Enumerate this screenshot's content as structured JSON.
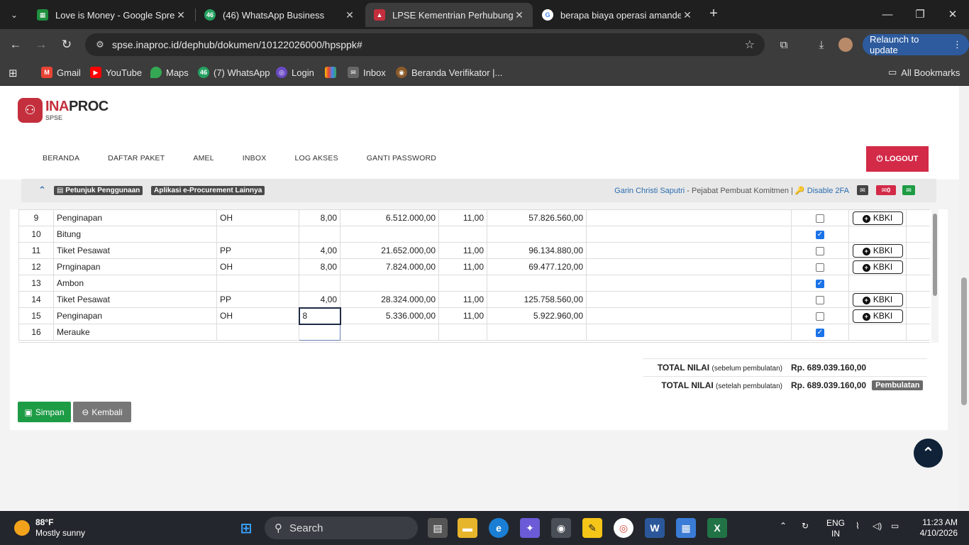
{
  "browser": {
    "tabs": [
      {
        "title": "Love is Money - Google Spread",
        "favicon": "sheets-icon"
      },
      {
        "title": "(46) WhatsApp Business",
        "favicon": "whatsapp-icon",
        "badge": "46"
      },
      {
        "title": "LPSE Kementrian Perhubungan",
        "favicon": "lpse-icon"
      },
      {
        "title": "berapa biaya operasi amandel",
        "favicon": "google-icon"
      }
    ],
    "url": "spse.inaproc.id/dephub/dokumen/10122026000/hpsppk#",
    "relaunch_label": "Relaunch to update",
    "bookmarks": [
      {
        "label": "Gmail"
      },
      {
        "label": "YouTube"
      },
      {
        "label": "Maps"
      },
      {
        "label": "(7) WhatsApp",
        "badge": "46"
      },
      {
        "label": "Login"
      },
      {
        "label": ""
      },
      {
        "label": "Inbox"
      },
      {
        "label": "Beranda Verifikator |..."
      }
    ],
    "all_bookmarks": "All Bookmarks"
  },
  "site": {
    "logo_ina": "INA",
    "logo_proc": "PROC",
    "logo_sub": "SPSE",
    "nav": [
      "BERANDA",
      "DAFTAR PAKET",
      "AMEL",
      "INBOX",
      "LOG AKSES",
      "GANTI PASSWORD"
    ],
    "logout": "LOGOUT",
    "pills": [
      "Petunjuk Penggunaan",
      "Aplikasi e-Procurement Lainnya"
    ],
    "user_name": "Garin Christi Saputri",
    "user_role": " - Pejabat Pembuat Komitmen | ",
    "disable_2fa": "Disable 2FA",
    "mail_count": "0"
  },
  "table": {
    "rows": [
      {
        "no": "9",
        "item": "Penginapan",
        "unit": "OH",
        "qty": "8,00",
        "price": "6.512.000,00",
        "tax": "11,00",
        "total": "57.826.560,00",
        "checked": false,
        "kbki": true
      },
      {
        "no": "10",
        "item": "Bitung",
        "unit": "",
        "qty": "",
        "price": "",
        "tax": "",
        "total": "",
        "checked": true,
        "kbki": false
      },
      {
        "no": "11",
        "item": "Tiket Pesawat",
        "unit": "PP",
        "qty": "4,00",
        "price": "21.652.000,00",
        "tax": "11,00",
        "total": "96.134.880,00",
        "checked": false,
        "kbki": true
      },
      {
        "no": "12",
        "item": "Prnginapan",
        "unit": "OH",
        "qty": "8,00",
        "price": "7.824.000,00",
        "tax": "11,00",
        "total": "69.477.120,00",
        "checked": false,
        "kbki": true
      },
      {
        "no": "13",
        "item": "Ambon",
        "unit": "",
        "qty": "",
        "price": "",
        "tax": "",
        "total": "",
        "checked": true,
        "kbki": false
      },
      {
        "no": "14",
        "item": "Tiket Pesawat",
        "unit": "PP",
        "qty": "4,00",
        "price": "28.324.000,00",
        "tax": "11,00",
        "total": "125.758.560,00",
        "checked": false,
        "kbki": true
      },
      {
        "no": "15",
        "item": "Penginapan",
        "unit": "OH",
        "qty": "8",
        "price": "5.336.000,00",
        "tax": "11,00",
        "total": "5.922.960,00",
        "checked": false,
        "kbki": true,
        "editing": true
      },
      {
        "no": "16",
        "item": "Merauke",
        "unit": "",
        "qty": "",
        "price": "",
        "tax": "",
        "total": "",
        "checked": true,
        "kbki": false
      }
    ],
    "kbki_label": "KBKI"
  },
  "totals": {
    "before_label": "TOTAL NILAI",
    "before_note": "(sebelum pembulatan)",
    "before_value": "Rp. 689.039.160,00",
    "after_label": "TOTAL NILAI",
    "after_note": "(setelah pembulatan)",
    "after_value": "Rp. 689.039.160,00",
    "round_button": "Pembulatan"
  },
  "buttons": {
    "save": "Simpan",
    "back": "Kembali"
  },
  "taskbar": {
    "temp": "88°F",
    "weather": "Mostly sunny",
    "search": "Search",
    "lang": "ENG",
    "region": "IN",
    "time": "11:23 AM",
    "date": "4/10/2026"
  }
}
